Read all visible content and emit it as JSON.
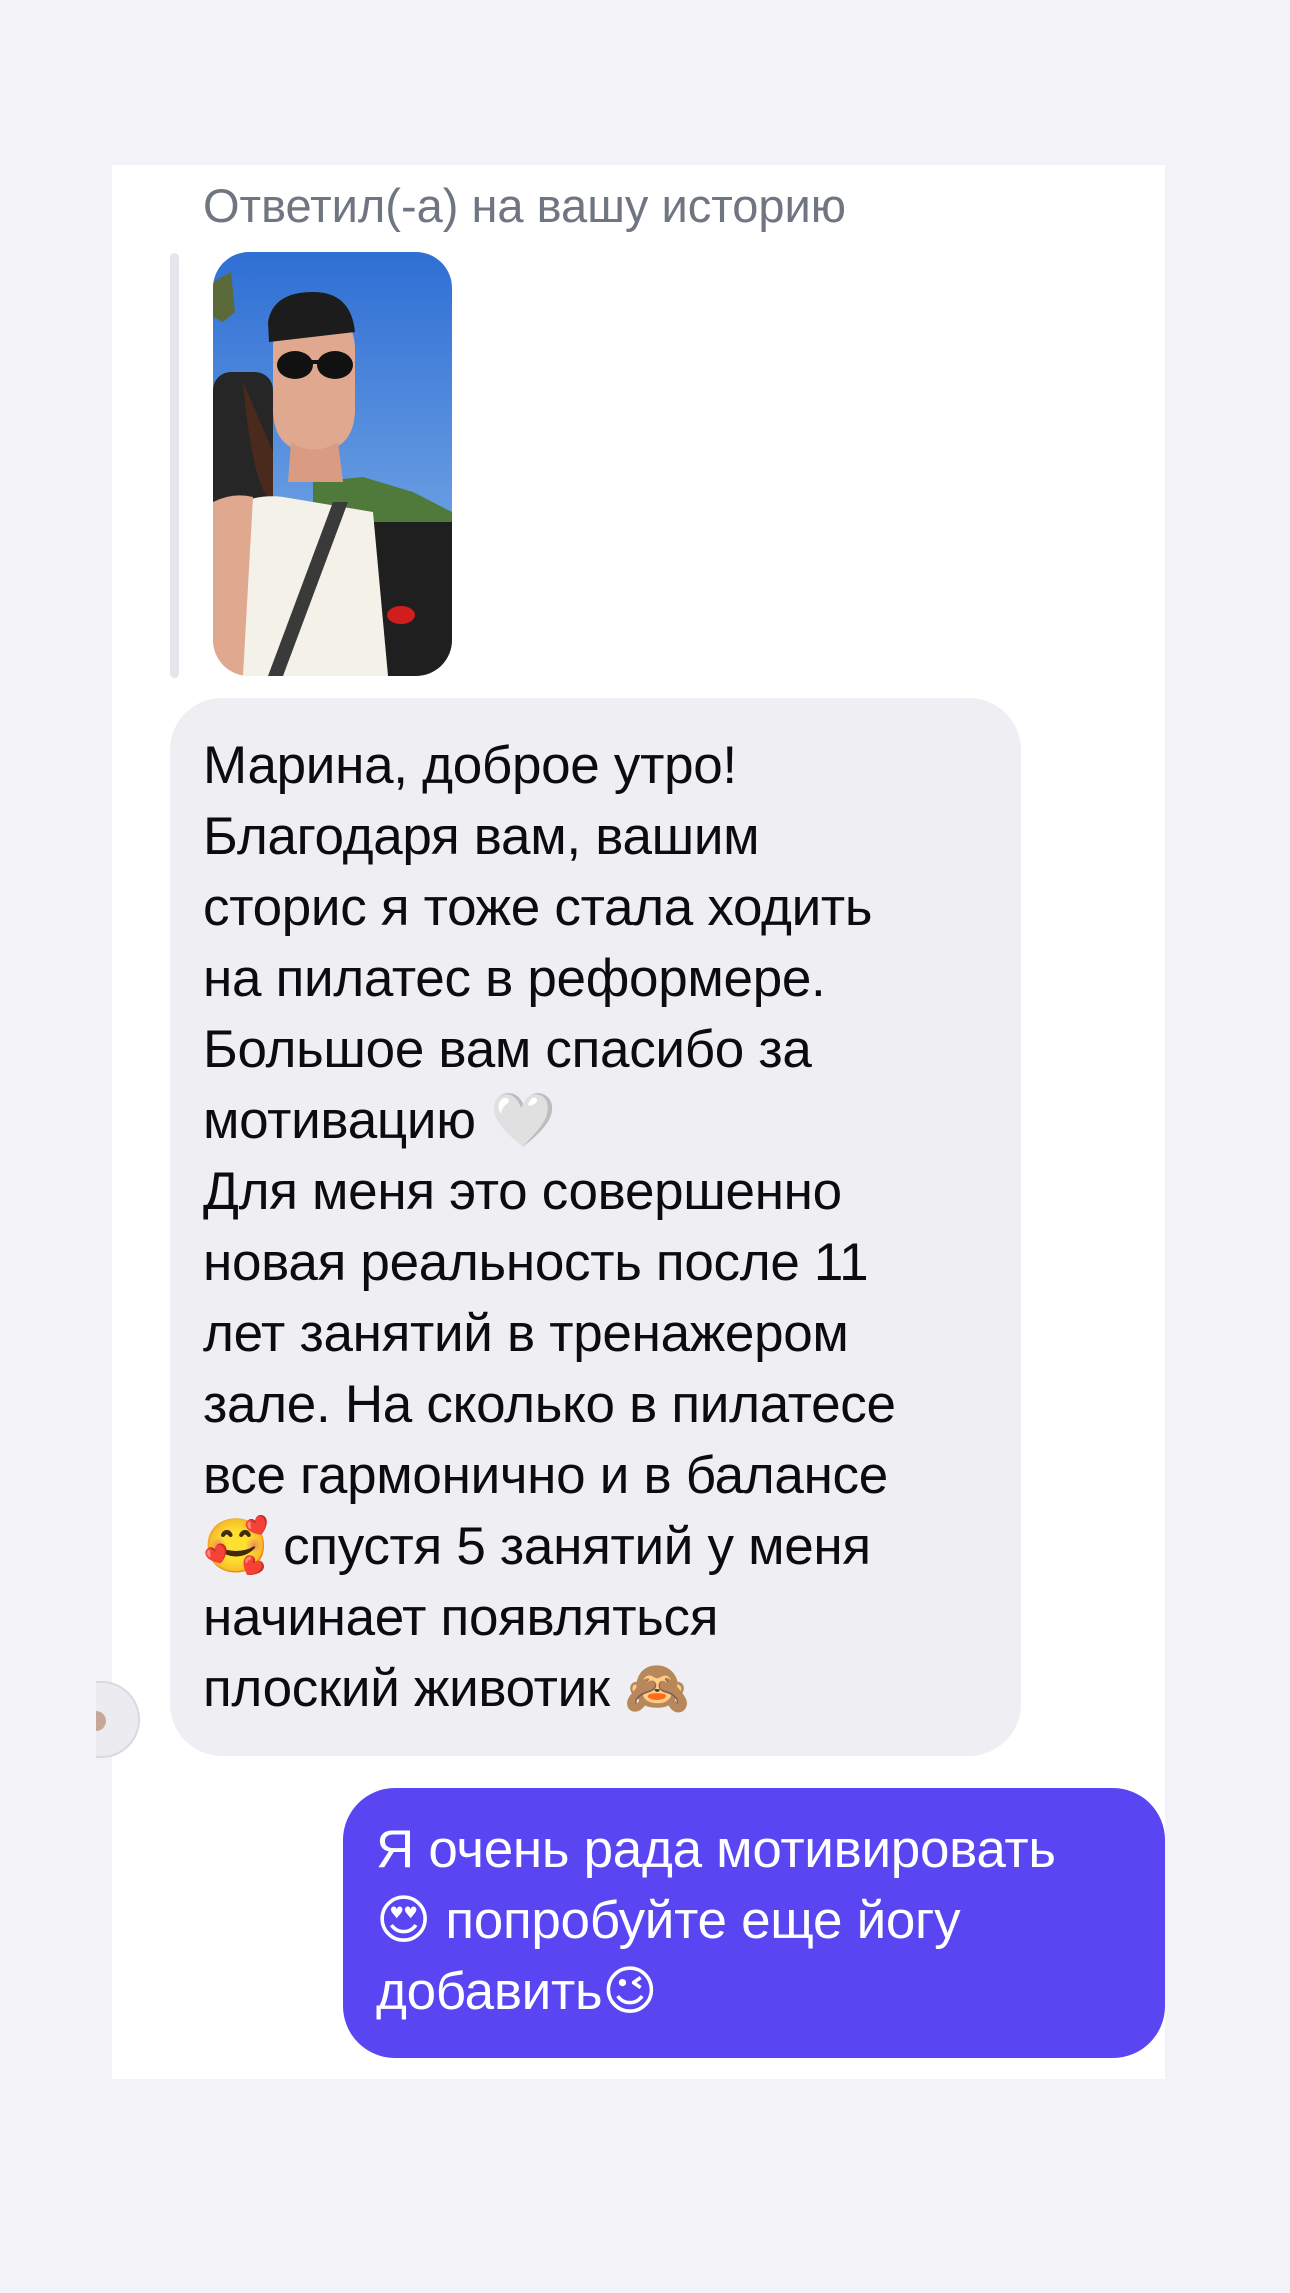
{
  "story_reply": {
    "label": "Ответил(-а) на вашу историю"
  },
  "incoming_message": {
    "lines": [
      "Марина, доброе утро!",
      "Благодаря вам, вашим",
      "сторис я тоже стала ходить",
      "на пилатес в реформере.",
      "Большое вам спасибо за",
      "мотивацию 🤍",
      "Для меня это совершенно",
      "новая реальность после 11",
      "лет занятий в тренажером",
      "зале. На сколько в пилатесе",
      "все гармонично и в балансе",
      "🥰 спустя 5 занятий у меня",
      "начинает появляться",
      "плоский животик 🙈"
    ]
  },
  "outgoing_message": {
    "lines": [
      "Я очень рада мотивировать",
      "😍 попробуйте еще йогу",
      "добавить😉"
    ]
  },
  "colors": {
    "background": "#f2f2f8",
    "incoming_bubble": "#efeff3",
    "outgoing_bubble": "#5946f2",
    "label_text": "#707582"
  }
}
